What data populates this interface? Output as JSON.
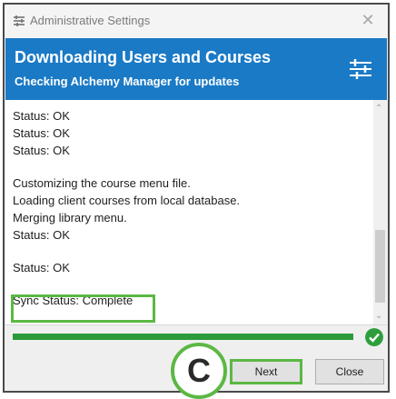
{
  "window": {
    "title": "Administrative Settings",
    "close_glyph": "✕"
  },
  "banner": {
    "title": "Downloading Users and Courses",
    "subtitle": "Checking Alchemy Manager for updates",
    "icon": "settings-sliders-icon",
    "color": "#1a7ac6"
  },
  "log": {
    "lines": [
      "Status: OK",
      "Status: OK",
      "Status: OK",
      "",
      "Customizing the course menu file.",
      "Loading client courses from local database.",
      "Merging library menu.",
      "Status: OK",
      "",
      "Status: OK",
      "",
      "Sync Status: Complete"
    ]
  },
  "progress": {
    "fraction": 1.0,
    "status_icon": "check-circle-icon",
    "color": "#2a9a3a"
  },
  "buttons": {
    "next_label": "Next",
    "close_label": "Close"
  },
  "callout": {
    "letter": "C",
    "color": "#5cb844"
  }
}
